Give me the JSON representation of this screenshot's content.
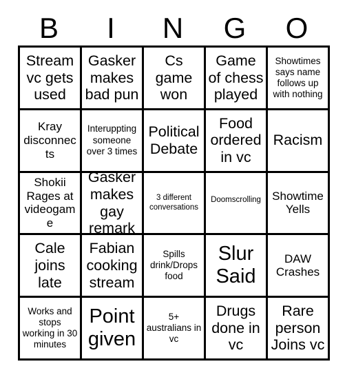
{
  "card": {
    "title_letters": [
      "B",
      "I",
      "N",
      "G",
      "O"
    ],
    "grid_size": 5,
    "colors": {
      "background": "#ffffff",
      "border": "#000000",
      "text": "#000000"
    },
    "rows": [
      [
        {
          "text": "Stream vc gets used",
          "size": "lg"
        },
        {
          "text": "Gasker makes bad pun",
          "size": "lg"
        },
        {
          "text": "Cs game won",
          "size": "lg"
        },
        {
          "text": "Game of chess played",
          "size": "lg"
        },
        {
          "text": "Showtimes says name follows up with nothing",
          "size": "sm"
        }
      ],
      [
        {
          "text": "Kray disconnects",
          "size": "md"
        },
        {
          "text": "Interuppting someone over 3 times",
          "size": "sm"
        },
        {
          "text": "Political Debate",
          "size": "lg"
        },
        {
          "text": "Food ordered in vc",
          "size": "lg"
        },
        {
          "text": "Racism",
          "size": "lg"
        }
      ],
      [
        {
          "text": "Shokii Rages at videogame",
          "size": "md"
        },
        {
          "text": "Gasker makes gay remark",
          "size": "lg"
        },
        {
          "text": "3 different conversations",
          "size": "xs"
        },
        {
          "text": "Doomscrolling",
          "size": "xs"
        },
        {
          "text": "Showtime Yells",
          "size": "md"
        }
      ],
      [
        {
          "text": "Cale joins late",
          "size": "lg"
        },
        {
          "text": "Fabian cooking stream",
          "size": "lg"
        },
        {
          "text": "Spills drink/Drops food",
          "size": "sm"
        },
        {
          "text": "Slur Said",
          "size": "xl"
        },
        {
          "text": "DAW Crashes",
          "size": "md"
        }
      ],
      [
        {
          "text": "Works and stops working in 30 minutes",
          "size": "sm"
        },
        {
          "text": "Point given",
          "size": "xl"
        },
        {
          "text": "5+ australians in vc",
          "size": "sm"
        },
        {
          "text": "Drugs done in vc",
          "size": "lg"
        },
        {
          "text": "Rare person Joins vc",
          "size": "lg"
        }
      ]
    ]
  }
}
